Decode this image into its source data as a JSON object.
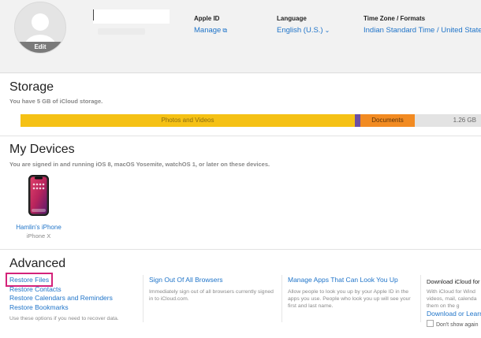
{
  "header": {
    "avatar_edit_label": "Edit",
    "apple_id": {
      "label": "Apple ID",
      "value": "Manage",
      "icon": "external-link-icon"
    },
    "language": {
      "label": "Language",
      "value": "English (U.S.)",
      "icon": "chevron-down-icon"
    },
    "timezone": {
      "label": "Time Zone / Formats",
      "value": "Indian Standard Time / United States"
    }
  },
  "storage": {
    "title": "Storage",
    "subtitle": "You have 5 GB of iCloud storage.",
    "segments": [
      {
        "label": "Photos and Videos",
        "color": "#f5c115"
      },
      {
        "label": "",
        "color": "#6c4fa3"
      },
      {
        "label": "Documents",
        "color": "#f28b22"
      },
      {
        "label": "1.26 GB",
        "color": "#e3e3e3"
      }
    ]
  },
  "devices": {
    "title": "My Devices",
    "subtitle": "You are signed in and running iOS 8, macOS Yosemite, watchOS 1, or later on these devices.",
    "items": [
      {
        "name": "Hamlin's iPhone",
        "model": "iPhone X"
      }
    ]
  },
  "advanced": {
    "title": "Advanced",
    "restore": {
      "links": [
        "Restore Files",
        "Restore Contacts",
        "Restore Calendars and Reminders",
        "Restore Bookmarks"
      ],
      "description": "Use these options if you need to recover data."
    },
    "signout": {
      "link": "Sign Out Of All Browsers",
      "description": "Immediately sign out of all browsers currently signed in to iCloud.com."
    },
    "manage_apps": {
      "link": "Manage Apps That Can Look You Up",
      "description": "Allow people to look you up by your Apple ID in the apps you use. People who look you up will see your first and last name."
    },
    "download": {
      "title": "Download iCloud for",
      "description": "With iCloud for Wind videos, mail, calenda them on the g",
      "link": "Download or Learn",
      "checkbox_label": "Don't show again"
    }
  },
  "colors": {
    "accent": "#1f74c9",
    "highlight": "#d4237a"
  }
}
